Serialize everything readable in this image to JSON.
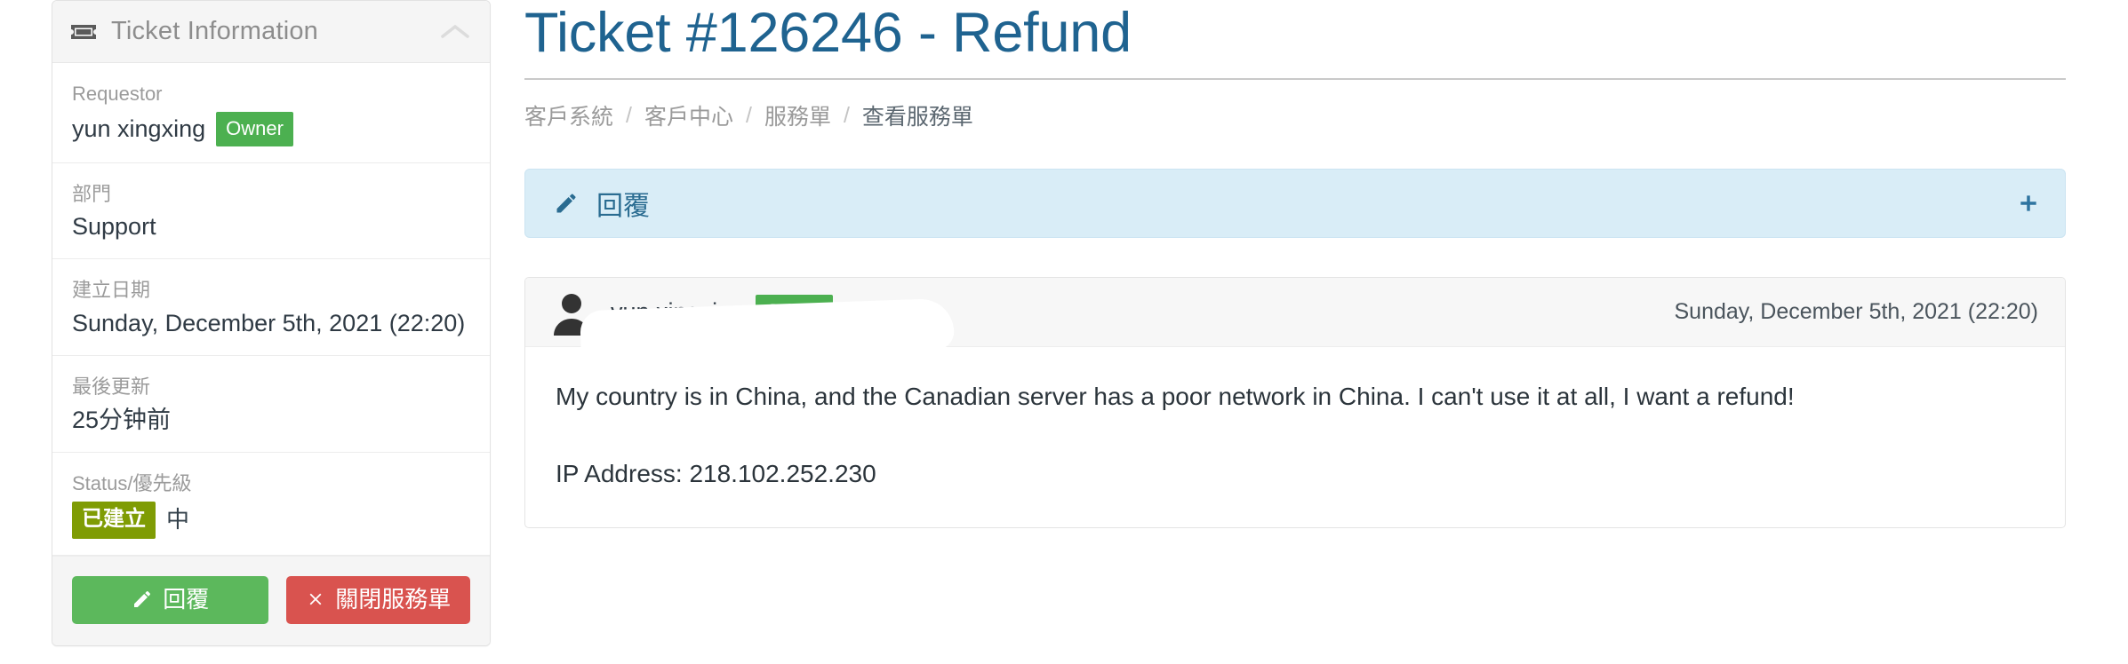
{
  "sidebar": {
    "panel_title": "Ticket Information",
    "panel_icon": "ticket-icon",
    "collapse_icon": "chevron-up-icon",
    "fields": [
      {
        "label": "Requestor",
        "value": "yun xingxing",
        "badge": "Owner"
      },
      {
        "label": "部門",
        "value": "Support"
      },
      {
        "label": "建立日期",
        "value": "Sunday, December 5th, 2021 (22:20)"
      },
      {
        "label": "最後更新",
        "value": "25分钟前"
      },
      {
        "label": "Status/優先級",
        "status_badge": "已建立",
        "priority": "中"
      }
    ],
    "buttons": {
      "reply": {
        "label": "回覆",
        "icon": "pencil-icon",
        "color": "#5cb85c"
      },
      "close": {
        "label": "關閉服務單",
        "icon": "times-icon",
        "color": "#d9534f"
      }
    }
  },
  "main": {
    "title": "Ticket #126246 - Refund",
    "title_color": "#1f6390",
    "breadcrumb": [
      {
        "label": "客戶系統",
        "active": false
      },
      {
        "label": "客戶中心",
        "active": false
      },
      {
        "label": "服務單",
        "active": false
      },
      {
        "label": "查看服務單",
        "active": true
      }
    ],
    "breadcrumb_separator": "/",
    "reply_bar": {
      "label": "回覆",
      "icon": "pencil-icon",
      "expand_icon": "plus-icon",
      "background": "#d9edf7"
    },
    "message": {
      "avatar_icon": "user-avatar-icon",
      "author": "vun xingxing",
      "author_badge": "Owner",
      "timestamp": "Sunday, December 5th, 2021 (22:20)",
      "paragraphs": [
        "My country is in China, and the Canadian server has a poor network in China. I can't use it at all, I want a refund!",
        "IP Address: 218.102.252.230"
      ]
    }
  }
}
